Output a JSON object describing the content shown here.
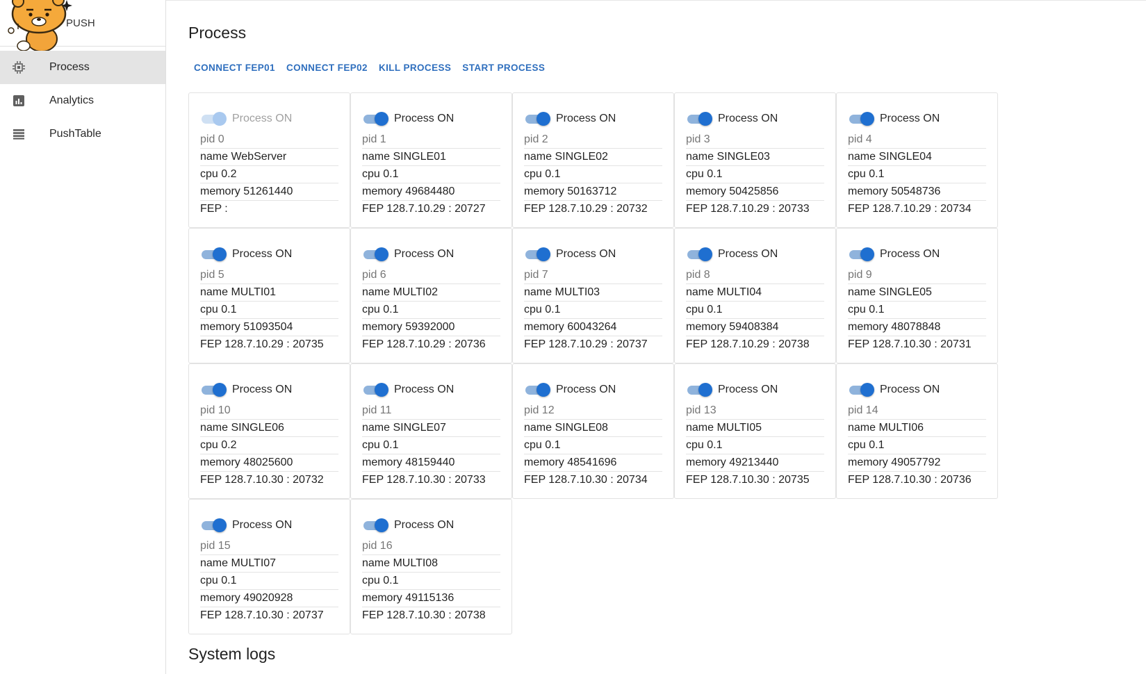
{
  "app": {
    "brand": "PUSH"
  },
  "sidebar": {
    "items": [
      {
        "label": "Process",
        "icon": "cpu-chip-icon",
        "active": true
      },
      {
        "label": "Analytics",
        "icon": "bar-chart-icon",
        "active": false
      },
      {
        "label": "PushTable",
        "icon": "table-rows-icon",
        "active": false
      }
    ]
  },
  "page": {
    "title": "Process",
    "actions": [
      "CONNECT FEP01",
      "CONNECT FEP02",
      "KILL PROCESS",
      "START PROCESS"
    ],
    "section_title": "System logs"
  },
  "colors": {
    "accent": "#1f6fd0",
    "action_text": "#2f6fbe",
    "active_nav_bg": "#e4e4e4"
  },
  "processes": [
    {
      "switch_label": "Process ON",
      "enabled": false,
      "pid": "pid 0",
      "name": "name WebServer",
      "cpu": "cpu 0.2",
      "memory": "memory 51261440",
      "fep": "FEP :"
    },
    {
      "switch_label": "Process ON",
      "enabled": true,
      "pid": "pid 1",
      "name": "name SINGLE01",
      "cpu": "cpu 0.1",
      "memory": "memory 49684480",
      "fep": "FEP 128.7.10.29 : 20727"
    },
    {
      "switch_label": "Process ON",
      "enabled": true,
      "pid": "pid 2",
      "name": "name SINGLE02",
      "cpu": "cpu 0.1",
      "memory": "memory 50163712",
      "fep": "FEP 128.7.10.29 : 20732"
    },
    {
      "switch_label": "Process ON",
      "enabled": true,
      "pid": "pid 3",
      "name": "name SINGLE03",
      "cpu": "cpu 0.1",
      "memory": "memory 50425856",
      "fep": "FEP 128.7.10.29 : 20733"
    },
    {
      "switch_label": "Process ON",
      "enabled": true,
      "pid": "pid 4",
      "name": "name SINGLE04",
      "cpu": "cpu 0.1",
      "memory": "memory 50548736",
      "fep": "FEP 128.7.10.29 : 20734"
    },
    {
      "switch_label": "Process ON",
      "enabled": true,
      "pid": "pid 5",
      "name": "name MULTI01",
      "cpu": "cpu 0.1",
      "memory": "memory 51093504",
      "fep": "FEP 128.7.10.29 : 20735"
    },
    {
      "switch_label": "Process ON",
      "enabled": true,
      "pid": "pid 6",
      "name": "name MULTI02",
      "cpu": "cpu 0.1",
      "memory": "memory 59392000",
      "fep": "FEP 128.7.10.29 : 20736"
    },
    {
      "switch_label": "Process ON",
      "enabled": true,
      "pid": "pid 7",
      "name": "name MULTI03",
      "cpu": "cpu 0.1",
      "memory": "memory 60043264",
      "fep": "FEP 128.7.10.29 : 20737"
    },
    {
      "switch_label": "Process ON",
      "enabled": true,
      "pid": "pid 8",
      "name": "name MULTI04",
      "cpu": "cpu 0.1",
      "memory": "memory 59408384",
      "fep": "FEP 128.7.10.29 : 20738"
    },
    {
      "switch_label": "Process ON",
      "enabled": true,
      "pid": "pid 9",
      "name": "name SINGLE05",
      "cpu": "cpu 0.1",
      "memory": "memory 48078848",
      "fep": "FEP 128.7.10.30 : 20731"
    },
    {
      "switch_label": "Process ON",
      "enabled": true,
      "pid": "pid 10",
      "name": "name SINGLE06",
      "cpu": "cpu 0.2",
      "memory": "memory 48025600",
      "fep": "FEP 128.7.10.30 : 20732"
    },
    {
      "switch_label": "Process ON",
      "enabled": true,
      "pid": "pid 11",
      "name": "name SINGLE07",
      "cpu": "cpu 0.1",
      "memory": "memory 48159440",
      "fep": "FEP 128.7.10.30 : 20733"
    },
    {
      "switch_label": "Process ON",
      "enabled": true,
      "pid": "pid 12",
      "name": "name SINGLE08",
      "cpu": "cpu 0.1",
      "memory": "memory 48541696",
      "fep": "FEP 128.7.10.30 : 20734"
    },
    {
      "switch_label": "Process ON",
      "enabled": true,
      "pid": "pid 13",
      "name": "name MULTI05",
      "cpu": "cpu 0.1",
      "memory": "memory 49213440",
      "fep": "FEP 128.7.10.30 : 20735"
    },
    {
      "switch_label": "Process ON",
      "enabled": true,
      "pid": "pid 14",
      "name": "name MULTI06",
      "cpu": "cpu 0.1",
      "memory": "memory 49057792",
      "fep": "FEP 128.7.10.30 : 20736"
    },
    {
      "switch_label": "Process ON",
      "enabled": true,
      "pid": "pid 15",
      "name": "name MULTI07",
      "cpu": "cpu 0.1",
      "memory": "memory 49020928",
      "fep": "FEP 128.7.10.30 : 20737"
    },
    {
      "switch_label": "Process ON",
      "enabled": true,
      "pid": "pid 16",
      "name": "name MULTI08",
      "cpu": "cpu 0.1",
      "memory": "memory 49115136",
      "fep": "FEP 128.7.10.30 : 20738"
    }
  ]
}
